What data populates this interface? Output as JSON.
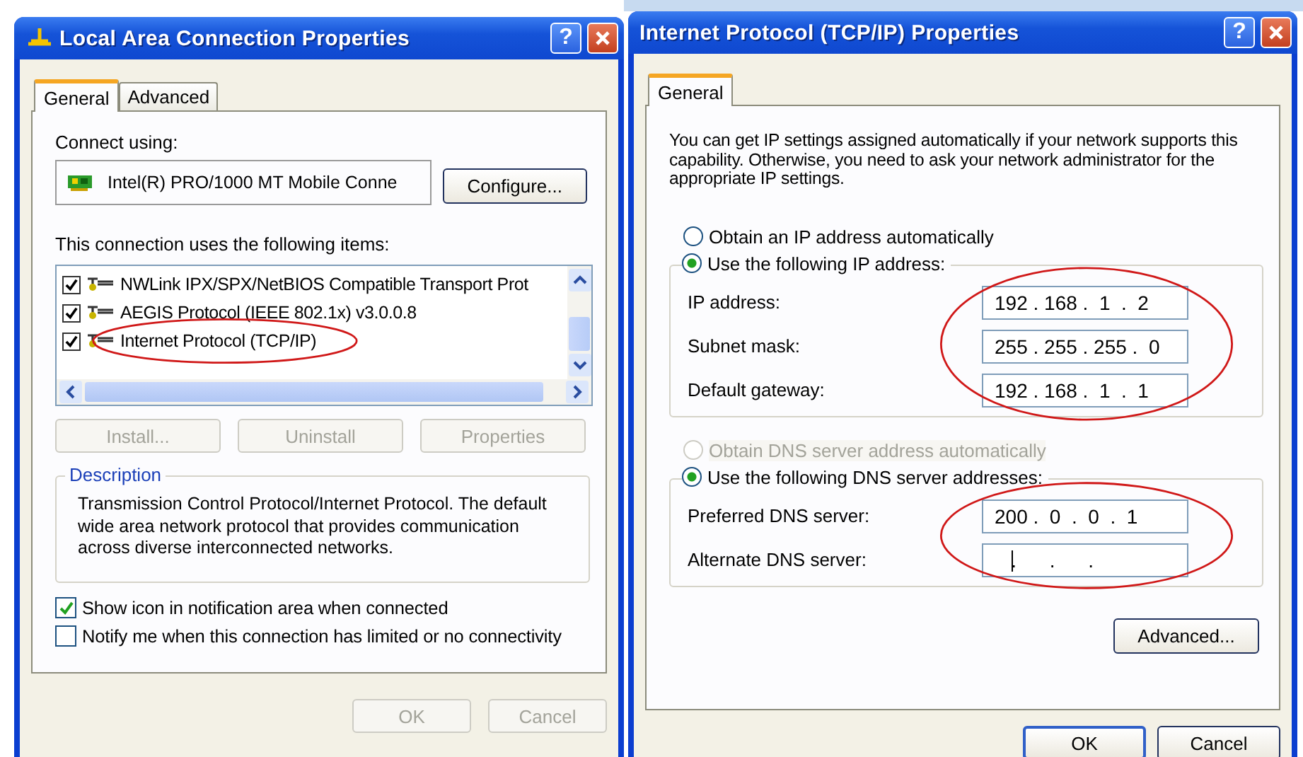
{
  "connection_window": {
    "title": "Local Area Connection Properties",
    "help": "?",
    "tabs": [
      {
        "label": "General",
        "selected": true
      },
      {
        "label": "Advanced",
        "selected": false
      }
    ],
    "connect_label": "Connect using:",
    "adapter": "Intel(R) PRO/1000 MT Mobile Conne",
    "configure": "Configure...",
    "items_label": "This connection uses the following items:",
    "items": [
      {
        "label": "NWLink IPX/SPX/NetBIOS Compatible Transport Prot",
        "checked": true,
        "circled": false
      },
      {
        "label": "AEGIS Protocol (IEEE 802.1x) v3.0.0.8",
        "checked": true,
        "circled": false
      },
      {
        "label": "Internet Protocol (TCP/IP)",
        "checked": true,
        "circled": true
      }
    ],
    "actions": [
      {
        "label": "Install...",
        "disabled": true
      },
      {
        "label": "Uninstall",
        "disabled": true
      },
      {
        "label": "Properties",
        "disabled": true
      }
    ],
    "description": {
      "title": "Description",
      "text": "Transmission Control Protocol/Internet Protocol. The default wide area network protocol that provides communication across diverse interconnected networks."
    },
    "options": [
      {
        "label": "Show icon in notification area when connected",
        "checked": true
      },
      {
        "label": "Notify me when this connection has limited or no connectivity",
        "checked": false
      }
    ],
    "buttons": [
      {
        "label": "OK",
        "disabled": true,
        "default": false
      },
      {
        "label": "Cancel",
        "disabled": true,
        "default": false
      }
    ]
  },
  "tcpip_window": {
    "title": "Internet Protocol (TCP/IP) Properties",
    "help": "?",
    "tabs": [
      {
        "label": "General",
        "selected": true
      }
    ],
    "intro": "You can get IP settings assigned automatically if your network supports this capability. Otherwise, you need to ask your network administrator for the appropriate IP settings.",
    "ip_mode": [
      {
        "label": "Obtain an IP address automatically",
        "selected": false,
        "disabled": false
      },
      {
        "label": "Use the following IP address:",
        "selected": true,
        "disabled": false
      }
    ],
    "ip_fields": {
      "circled": true,
      "rows": [
        {
          "label": "IP address:",
          "value": "192 . 168 .  1  .  2",
          "cursor": false
        },
        {
          "label": "Subnet mask:",
          "value": "255 . 255 . 255 .  0",
          "cursor": false
        },
        {
          "label": "Default gateway:",
          "value": "192 . 168 .  1  .  1",
          "cursor": false
        }
      ]
    },
    "dns_mode": [
      {
        "label": "Obtain DNS server address automatically",
        "selected": false,
        "disabled": true
      },
      {
        "label": "Use the following DNS server addresses:",
        "selected": true,
        "disabled": false
      }
    ],
    "dns_fields": {
      "circled": true,
      "rows": [
        {
          "label": "Preferred DNS server:",
          "value": "200 .  0  .  0  .  1",
          "cursor": false
        },
        {
          "label": "Alternate DNS server:",
          "value": "   .      .      .",
          "cursor": true
        }
      ]
    },
    "advanced": "Advanced...",
    "buttons": [
      {
        "label": "OK",
        "disabled": false,
        "default": true
      },
      {
        "label": "Cancel",
        "disabled": false,
        "default": false
      }
    ]
  }
}
